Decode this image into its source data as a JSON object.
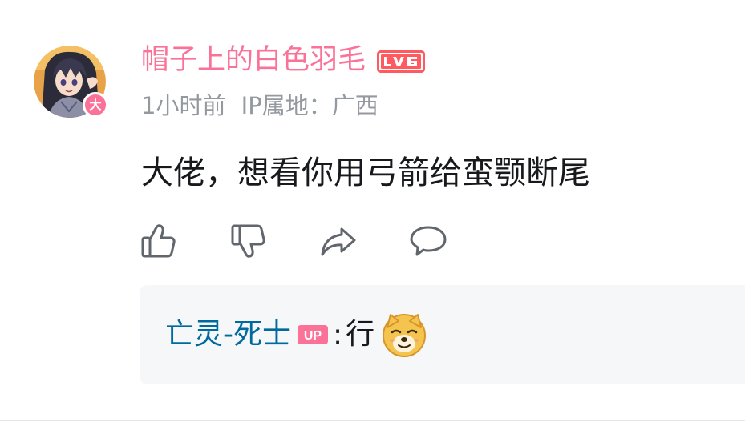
{
  "comment": {
    "username": "帽子上的白色羽毛",
    "level_badge": "LV6",
    "vip_badge": "大",
    "time": "1小时前",
    "location": "IP属地：广西",
    "content": "大佬，想看你用弓箭给蛮颚断尾",
    "actions": {
      "like_icon": "thumbs-up-icon",
      "dislike_icon": "thumbs-down-icon",
      "share_icon": "share-icon",
      "reply_icon": "comment-bubble-icon"
    }
  },
  "reply": {
    "username": "亡灵-死士",
    "badge": "UP",
    "separator": ":",
    "text": "行",
    "emoji": "doge-emoji"
  },
  "colors": {
    "accent_pink": "#fb7299",
    "reply_user_blue": "#00699d",
    "meta_gray": "#9499a0",
    "reply_bg": "#f6f7f8"
  }
}
